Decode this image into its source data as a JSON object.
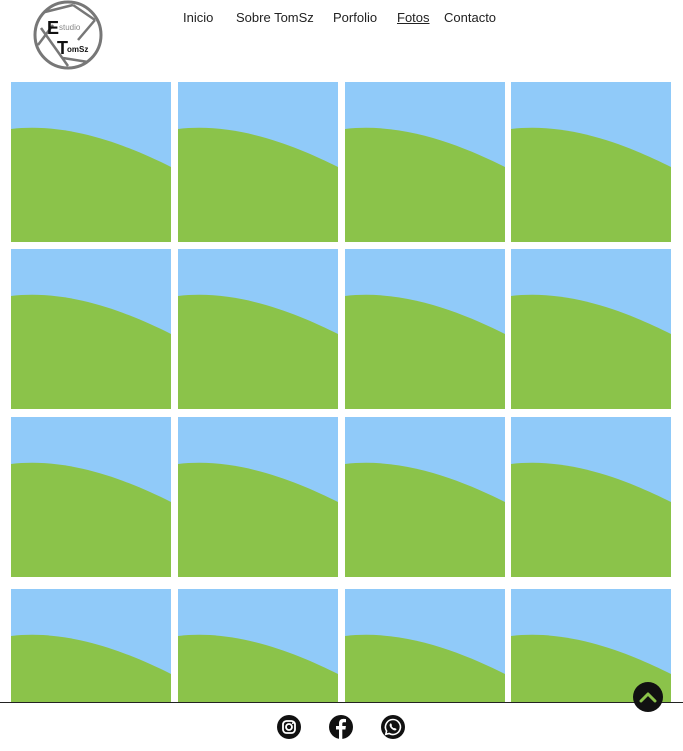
{
  "logo": {
    "letter_e": "E",
    "word_studio": "studio",
    "letter_t": "T",
    "word_omsz": "omSz"
  },
  "nav": {
    "items": [
      {
        "label": "Inicio",
        "active": false
      },
      {
        "label": "Sobre TomSz",
        "active": false
      },
      {
        "label": "Porfolio",
        "active": false
      },
      {
        "label": "Fotos",
        "active": true
      },
      {
        "label": "Contacto",
        "active": false
      }
    ]
  },
  "gallery": {
    "placeholder_icon": "image-placeholder-icon",
    "count": 16,
    "colors": {
      "sky": "#90caf9",
      "grass": "#8bc34a"
    }
  },
  "footer": {
    "social": [
      {
        "icon": "instagram-icon"
      },
      {
        "icon": "facebook-icon"
      },
      {
        "icon": "whatsapp-icon"
      }
    ]
  },
  "scroll_top": {
    "icon": "chevron-up-icon",
    "icon_color": "#8bc34a"
  }
}
